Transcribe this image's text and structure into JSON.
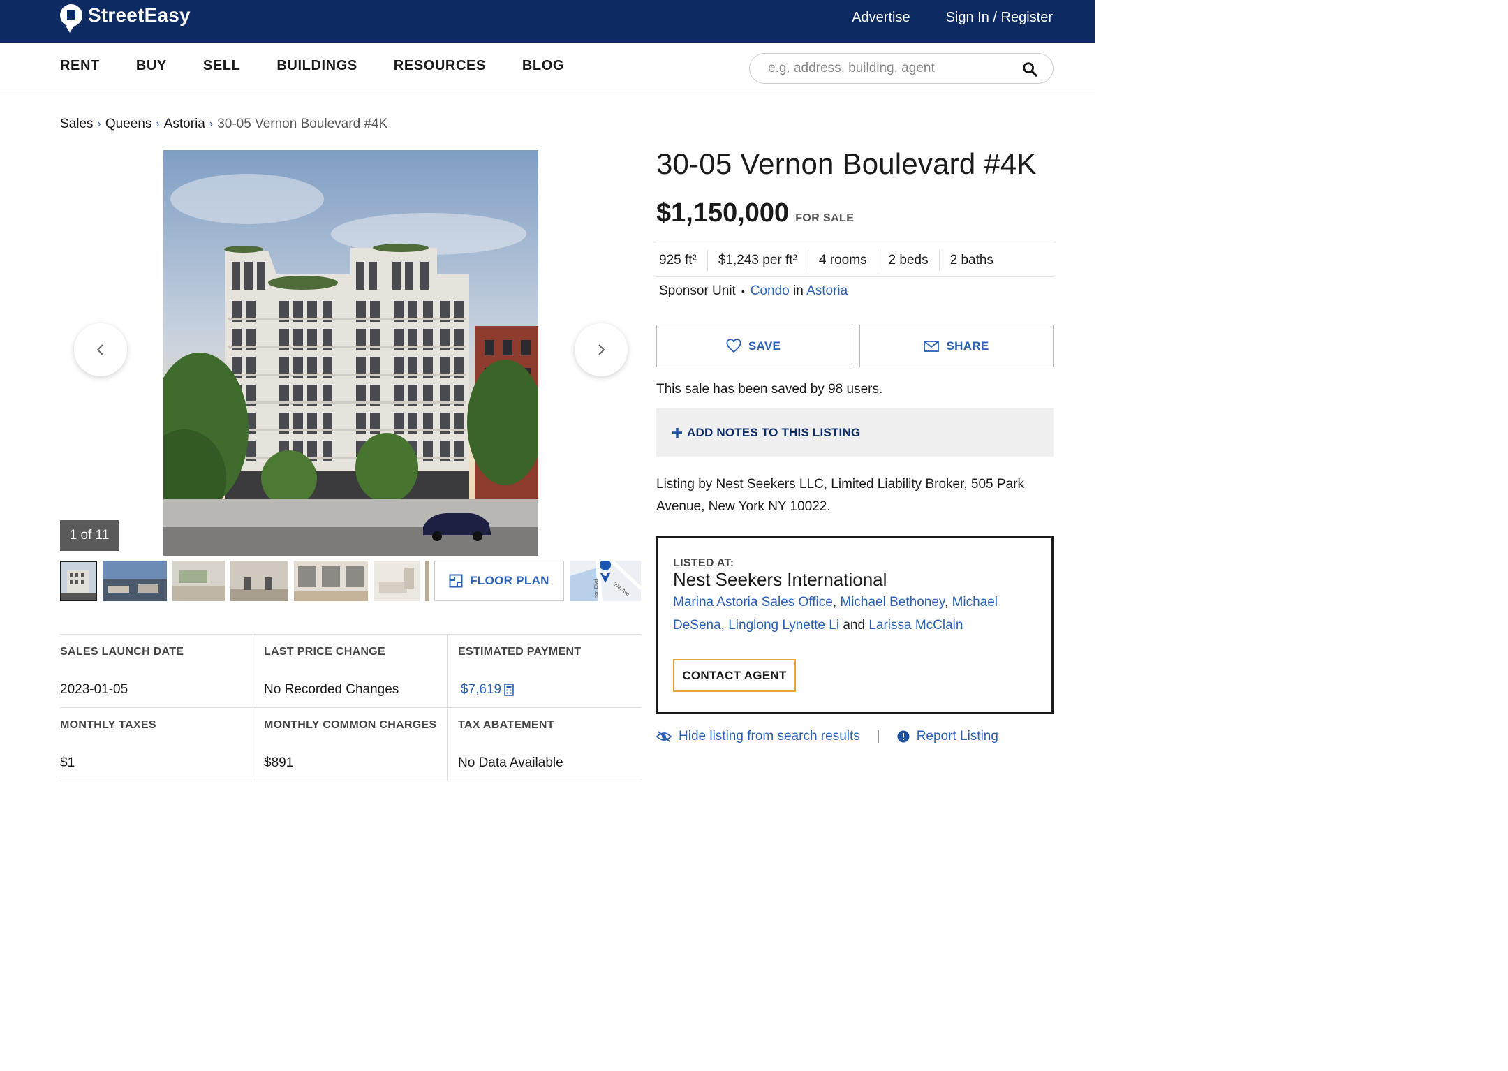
{
  "header": {
    "brand": "StreetEasy",
    "advertise": "Advertise",
    "sign_in": "Sign In / Register"
  },
  "nav": {
    "items": [
      "RENT",
      "BUY",
      "SELL",
      "BUILDINGS",
      "RESOURCES",
      "BLOG"
    ],
    "search_placeholder": "e.g. address, building, agent"
  },
  "breadcrumb": {
    "items": [
      "Sales",
      "Queens",
      "Astoria"
    ],
    "current": "30-05 Vernon Boulevard #4K"
  },
  "gallery": {
    "counter": "1 of 11",
    "floor_plan": "FLOOR PLAN",
    "map_labels": [
      "30th Ave",
      "non Blvd"
    ]
  },
  "details": {
    "rows": [
      [
        {
          "label": "SALES LAUNCH DATE",
          "value": "2023-01-05"
        },
        {
          "label": "LAST PRICE CHANGE",
          "value": "No Recorded Changes"
        },
        {
          "label": "ESTIMATED PAYMENT",
          "value": "$7,619"
        }
      ],
      [
        {
          "label": "MONTHLY TAXES",
          "value": "$1"
        },
        {
          "label": "MONTHLY COMMON CHARGES",
          "value": "$891"
        },
        {
          "label": "TAX ABATEMENT",
          "value": "No Data Available"
        }
      ]
    ]
  },
  "listing": {
    "title": "30-05 Vernon Boulevard #4K",
    "price": "$1,150,000",
    "status": "FOR SALE",
    "facts": [
      "925 ft²",
      "$1,243 per ft²",
      "4 rooms",
      "2 beds",
      "2 baths"
    ],
    "unit_type": "Sponsor Unit",
    "property_type": "Condo",
    "in": "in",
    "neighborhood": "Astoria",
    "save_label": "SAVE",
    "share_label": "SHARE",
    "saved_text": "This sale has been saved by 98 users.",
    "add_notes": "ADD NOTES TO THIS LISTING",
    "listing_by": "Listing by Nest Seekers LLC, Limited Liability Broker, 505 Park Avenue, New York NY 10022.",
    "listed_at_label": "LISTED AT:",
    "listed_at_firm": "Nest Seekers International",
    "agents": [
      "Marina Astoria Sales Office",
      "Michael Bethoney",
      "Michael DeSena",
      "Linglong Lynette Li",
      "Larissa McClain"
    ],
    "and_word": "and",
    "contact_agent": "CONTACT AGENT",
    "hide_listing": "Hide listing from search results",
    "report_listing": "Report Listing"
  },
  "colors": {
    "brand_navy": "#0e2a63",
    "link_blue": "#2a61b7",
    "contact_border": "#e8a33a"
  }
}
